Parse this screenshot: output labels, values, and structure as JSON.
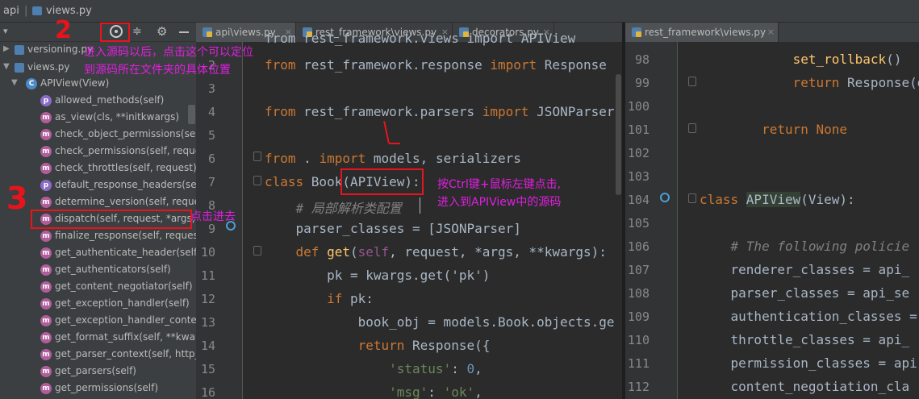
{
  "breadcrumb": [
    "api",
    "views.py"
  ],
  "toolbar": {
    "icons": [
      "locate-icon",
      "collapse-icon",
      "gear-icon",
      "minimize-icon"
    ]
  },
  "tree": {
    "items": [
      {
        "label": "versioning.py",
        "kind": "file"
      },
      {
        "label": "views.py",
        "kind": "file"
      },
      {
        "label": "APIView(View)",
        "kind": "class"
      },
      {
        "label": "allowed_methods(self)",
        "kind": "property"
      },
      {
        "label": "as_view(cls, **initkwargs)",
        "kind": "method"
      },
      {
        "label": "check_object_permissions(self",
        "kind": "method"
      },
      {
        "label": "check_permissions(self, reque",
        "kind": "method"
      },
      {
        "label": "check_throttles(self, request)",
        "kind": "method"
      },
      {
        "label": "default_response_headers(self)",
        "kind": "property"
      },
      {
        "label": "determine_version(self, reques",
        "kind": "method"
      },
      {
        "label": "dispatch(self, request, *args,",
        "kind": "method"
      },
      {
        "label": "finalize_response(self, request",
        "kind": "method"
      },
      {
        "label": "get_authenticate_header(self, r",
        "kind": "method"
      },
      {
        "label": "get_authenticators(self)",
        "kind": "method"
      },
      {
        "label": "get_content_negotiator(self)",
        "kind": "method"
      },
      {
        "label": "get_exception_handler(self)",
        "kind": "method"
      },
      {
        "label": "get_exception_handler_context",
        "kind": "method"
      },
      {
        "label": "get_format_suffix(self, **kwarg",
        "kind": "method"
      },
      {
        "label": "get_parser_context(self, http_r",
        "kind": "method"
      },
      {
        "label": "get_parsers(self)",
        "kind": "method"
      },
      {
        "label": "get_permissions(self)",
        "kind": "method"
      }
    ]
  },
  "tabs_left": [
    {
      "label": "api\\views.py",
      "active": true
    },
    {
      "label": "rest_framework\\views.py",
      "active": false
    },
    {
      "label": "decorators.py",
      "active": false
    }
  ],
  "tabs_right": [
    {
      "label": "rest_framework\\views.py",
      "active": true
    }
  ],
  "left_editor": {
    "line_numbers": [
      "",
      "2",
      "3",
      "4",
      "5",
      "6",
      "7",
      "8",
      "9",
      "10",
      "11",
      "12",
      "13",
      "14",
      "15",
      "16"
    ],
    "lines": [
      "from rest_framework.views import APIView",
      "from rest_framework.response import Response",
      "",
      "from rest_framework.parsers import JSONParser",
      "",
      "from . import models, serializers",
      "class Book(APIView):",
      "    # 局部解析类配置",
      "    parser_classes = [JSONParser]",
      "    def get(self, request, *args, **kwargs):",
      "        pk = kwargs.get('pk')",
      "        if pk:",
      "            book_obj = models.Book.objects.ge",
      "            return Response({",
      "                'status': 0,",
      "                'msg': 'ok',"
    ]
  },
  "right_editor": {
    "line_numbers": [
      "98",
      "99",
      "100",
      "101",
      "102",
      "103",
      "104",
      "105",
      "106",
      "107",
      "108",
      "109",
      "110",
      "111",
      "112"
    ],
    "lines": [
      "            set_rollback()",
      "            return Response(data",
      "",
      "        return None",
      "",
      "",
      "class APIView(View):",
      "",
      "    # The following policie",
      "    renderer_classes = api_",
      "    parser_classes = api_se",
      "    authentication_classes =",
      "    throttle_classes = api_",
      "    permission_classes = api",
      "    content_negotiation_cla"
    ]
  },
  "annotations": {
    "locate_note_1": "进入源码以后，点击这个可以定位",
    "locate_note_2": "到源码所在文件夹的具体位置",
    "ctrl_note_1": "按Ctrl键+鼠标左键点击,",
    "ctrl_note_2": "进入到APIView中的源码",
    "dispatch_note": "点击进去",
    "mark_2": "2",
    "mark_3": "3"
  },
  "colors": {
    "annotation": "#e11ee1",
    "highlight_box": "#e8141c",
    "keyword": "#cc7832",
    "string": "#6a8759",
    "function": "#ffc66d"
  }
}
